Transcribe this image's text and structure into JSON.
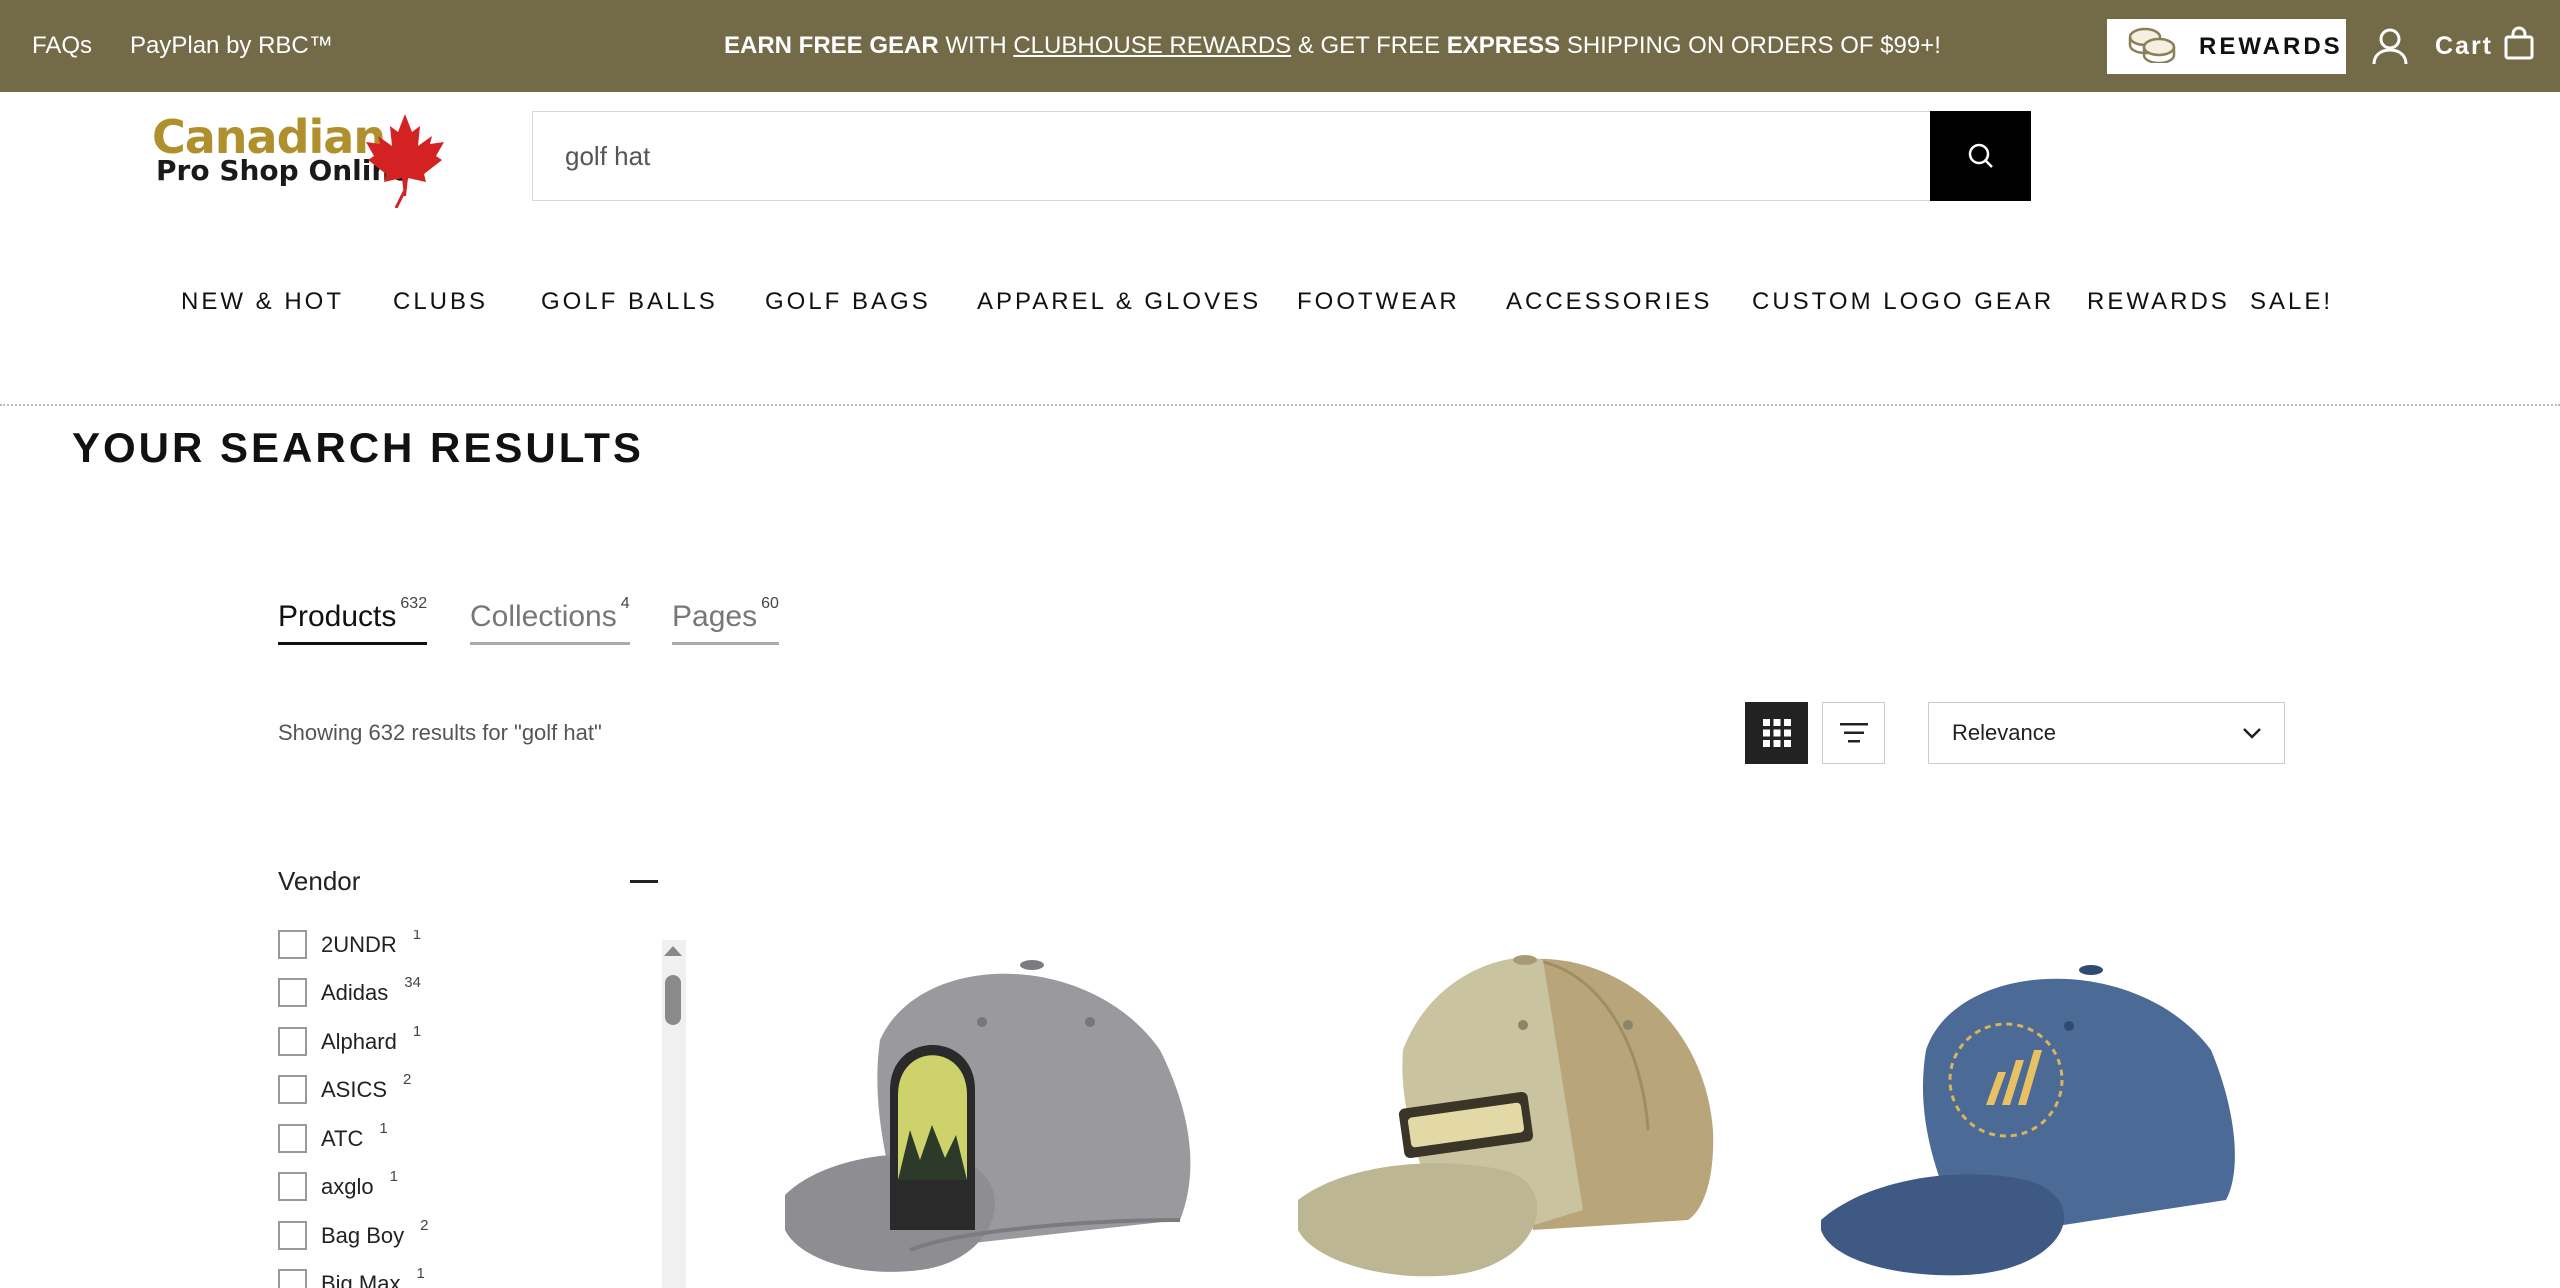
{
  "topbar": {
    "links": [
      "FAQs",
      "PayPlan by RBC™"
    ],
    "promo": {
      "part1": "EARN FREE GEAR",
      "part2": " WITH ",
      "part3": "CLUBHOUSE REWARDS",
      "part4": " & GET FREE ",
      "part5": "EXPRESS",
      "part6": " SHIPPING ON ORDERS OF $99+!"
    },
    "rewards_label": "REWARDS",
    "cart_label": "Cart"
  },
  "logo": {
    "line1": "Canadian",
    "line2": "Pro Shop Online"
  },
  "search": {
    "value": "golf hat",
    "placeholder": "Search"
  },
  "nav": {
    "items": [
      "NEW & HOT",
      "CLUBS",
      "GOLF BALLS",
      "GOLF BAGS",
      "APPAREL & GLOVES",
      "FOOTWEAR",
      "ACCESSORIES",
      "CUSTOM LOGO GEAR",
      "REWARDS",
      "SALE!"
    ]
  },
  "results": {
    "title": "YOUR SEARCH RESULTS",
    "tabs": [
      {
        "label": "Products",
        "count": "632"
      },
      {
        "label": "Collections",
        "count": "4"
      },
      {
        "label": "Pages",
        "count": "60"
      }
    ],
    "showing": "Showing 632 results for \"golf hat\"",
    "sort_value": "Relevance"
  },
  "filters": {
    "vendor_title": "Vendor",
    "vendors": [
      {
        "name": "2UNDR",
        "count": "1"
      },
      {
        "name": "Adidas",
        "count": "34"
      },
      {
        "name": "Alphard",
        "count": "1"
      },
      {
        "name": "ASICS",
        "count": "2"
      },
      {
        "name": "ATC",
        "count": "1"
      },
      {
        "name": "axglo",
        "count": "1"
      },
      {
        "name": "Bag Boy",
        "count": "2"
      },
      {
        "name": "Big Max",
        "count": "1"
      }
    ]
  },
  "products": [
    {
      "image": "grey-cap-with-patch"
    },
    {
      "image": "khaki-trucker-cap"
    },
    {
      "image": "navy-cap-with-logo"
    }
  ],
  "colors": {
    "topbar_bg": "#736a48",
    "logo_gold": "#b0902c",
    "maple_red": "#d42222",
    "search_button": "#000000"
  }
}
